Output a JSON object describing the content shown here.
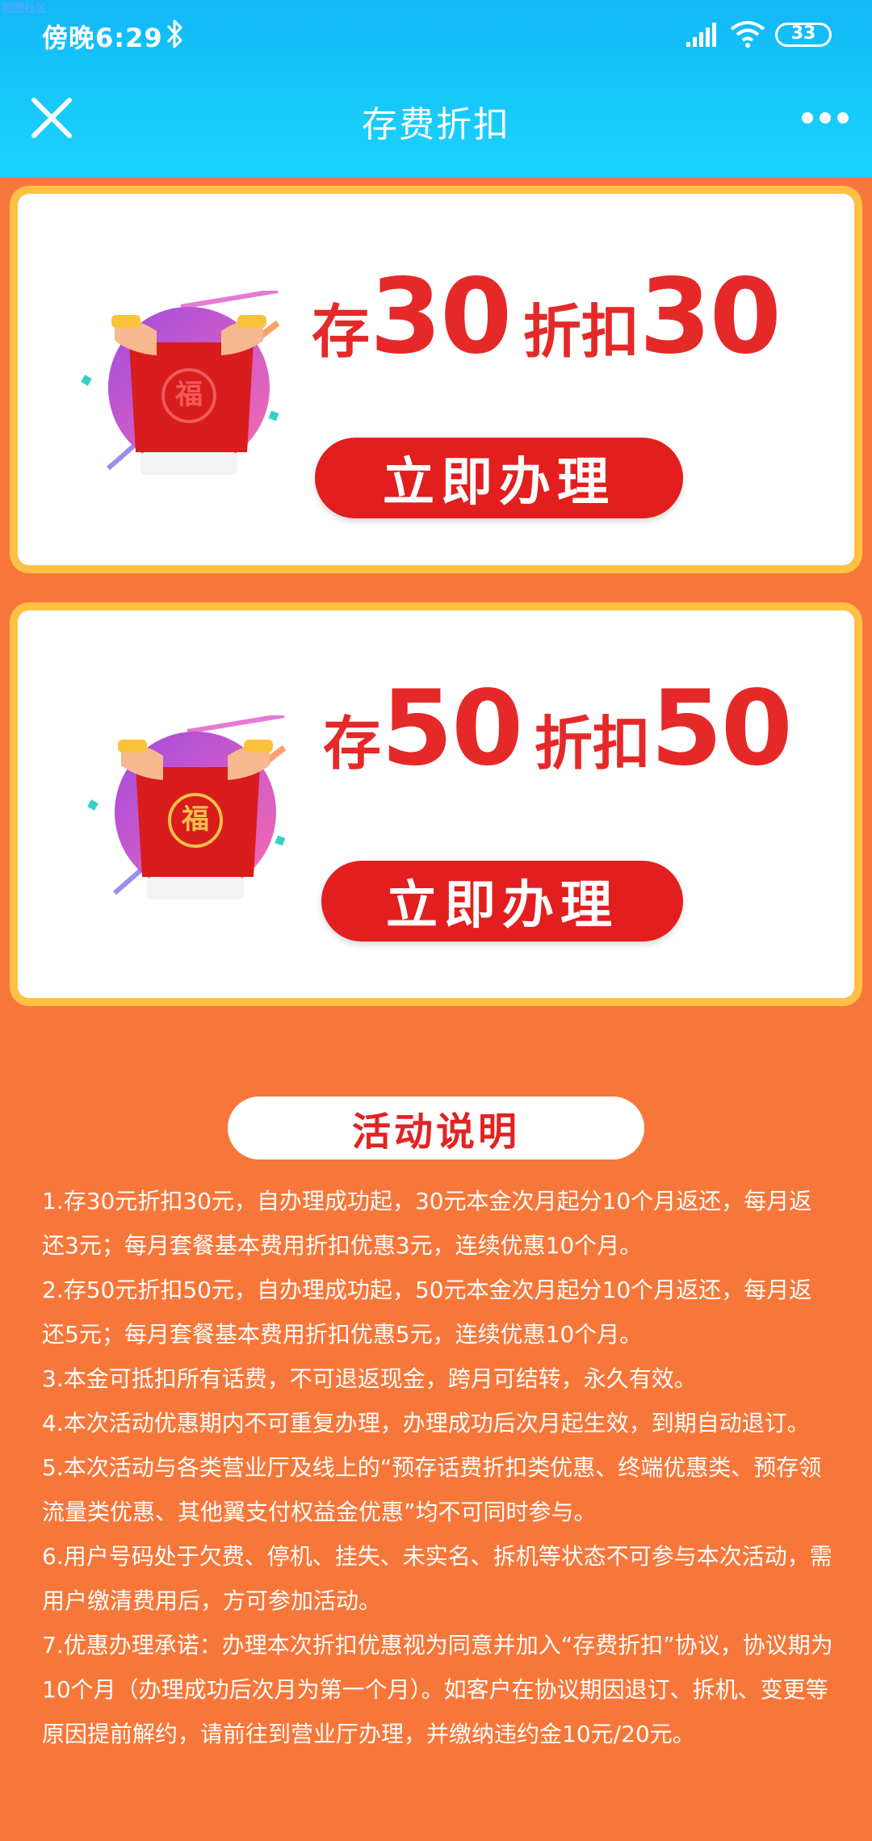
{
  "watermark": "图图社区",
  "status": {
    "time": "傍晚6:29",
    "battery": "33"
  },
  "nav": {
    "title": "存费折扣"
  },
  "offers": [
    {
      "save_prefix": "存",
      "save_amount": "30",
      "discount_label": "折扣",
      "discount_amount": "30",
      "button": "立即办理"
    },
    {
      "save_prefix": "存",
      "save_amount": "50",
      "discount_label": "折扣",
      "discount_amount": "50",
      "button": "立即办理"
    }
  ],
  "info": {
    "title": "活动说明",
    "rules": [
      "1.存30元折扣30元，自办理成功起，30元本金次月起分10个月返还，每月返还3元；每月套餐基本费用折扣优惠3元，连续优惠10个月。",
      "2.存50元折扣50元，自办理成功起，50元本金次月起分10个月返还，每月返还5元；每月套餐基本费用折扣优惠5元，连续优惠10个月。",
      "3.本金可抵扣所有话费，不可退返现金，跨月可结转，永久有效。",
      "4.本次活动优惠期内不可重复办理，办理成功后次月起生效，到期自动退订。",
      "5.本次活动与各类营业厅及线上的“预存话费折扣类优惠、终端优惠类、预存领流量类优惠、其他翼支付权益金优惠”均不可同时参与。",
      "6.用户号码处于欠费、停机、挂失、未实名、拆机等状态不可参与本次活动，需用户缴清费用后，方可参加活动。",
      "7.优惠办理承诺：办理本次折扣优惠视为同意并加入“存费折扣”协议，协议期为10个月（办理成功后次月为第一个月）。如客户在协议期因退订、拆机、变更等原因提前解约，请前往到营业厅办理，并缴纳违约金10元/20元。"
    ]
  },
  "colors": {
    "header": "#17C9FB",
    "page_bg": "#F7773A",
    "card_border": "#FFC044",
    "accent_red": "#E21E1E"
  },
  "icons": [
    "bluetooth-icon",
    "signal-icon",
    "wifi-icon",
    "battery-icon",
    "close-icon",
    "more-icon",
    "red-envelope-icon"
  ]
}
